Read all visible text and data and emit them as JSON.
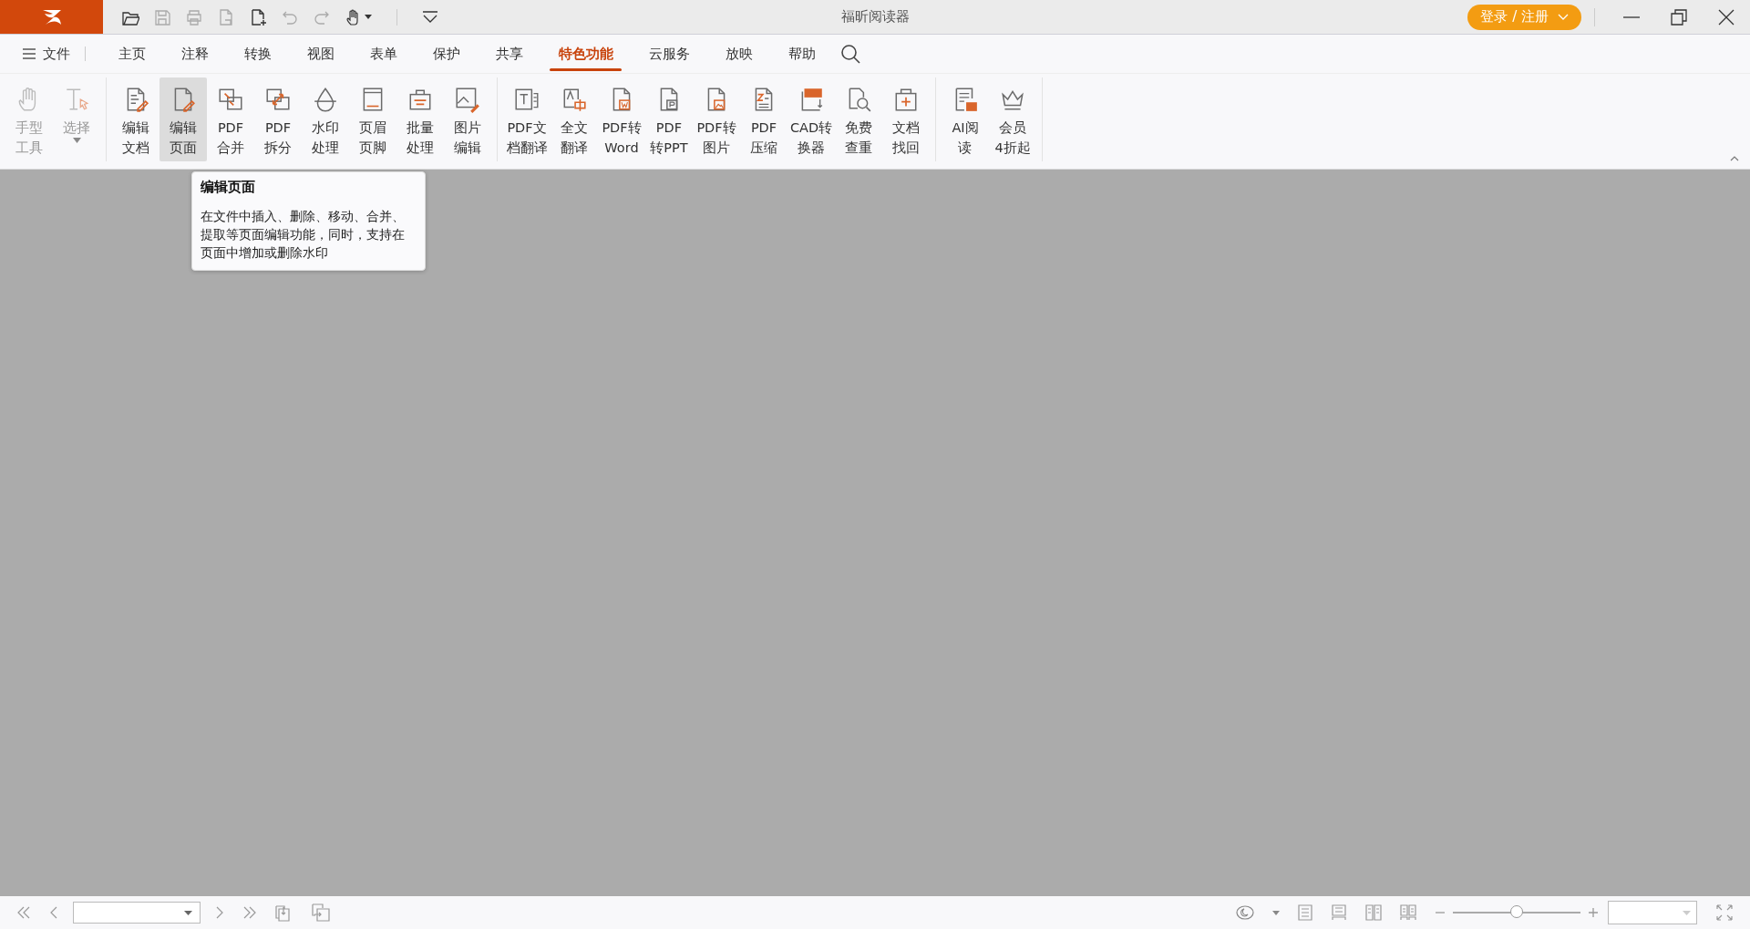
{
  "window": {
    "title": "福昕阅读器"
  },
  "quick_access": [
    {
      "kind": "folder",
      "disabled": false
    },
    {
      "kind": "save",
      "disabled": true
    },
    {
      "kind": "print",
      "disabled": true
    },
    {
      "kind": "doc",
      "disabled": true
    },
    {
      "kind": "new",
      "disabled": false
    },
    {
      "kind": "undo",
      "disabled": true
    },
    {
      "kind": "redo",
      "disabled": true
    },
    {
      "kind": "hand",
      "disabled": false
    }
  ],
  "login_button": {
    "label": "登录 / 注册"
  },
  "menu": {
    "file": "文件",
    "tabs": [
      {
        "label": "主页",
        "selected": false
      },
      {
        "label": "注释",
        "selected": false
      },
      {
        "label": "转换",
        "selected": false
      },
      {
        "label": "视图",
        "selected": false
      },
      {
        "label": "表单",
        "selected": false
      },
      {
        "label": "保护",
        "selected": false
      },
      {
        "label": "共享",
        "selected": false
      },
      {
        "label": "特色功能",
        "selected": true
      },
      {
        "label": "云服务",
        "selected": false
      },
      {
        "label": "放映",
        "selected": false
      },
      {
        "label": "帮助",
        "selected": false
      }
    ]
  },
  "ribbon": {
    "groups": [
      {
        "tools": [
          {
            "kind": "hand",
            "lines": [
              "手型",
              "工具"
            ],
            "disabled": true,
            "selected": false
          },
          {
            "kind": "select",
            "lines": [
              "选择"
            ],
            "disabled": true,
            "selected": false
          }
        ]
      },
      {
        "tools": [
          {
            "kind": "edit-doc",
            "lines": [
              "编辑",
              "文档"
            ],
            "disabled": false,
            "selected": false
          },
          {
            "kind": "edit-page",
            "lines": [
              "编辑",
              "页面"
            ],
            "disabled": false,
            "selected": true
          },
          {
            "kind": "merge",
            "lines": [
              "PDF",
              "合并"
            ],
            "disabled": false,
            "selected": false
          },
          {
            "kind": "split",
            "lines": [
              "PDF",
              "拆分"
            ],
            "disabled": false,
            "selected": false
          },
          {
            "kind": "watermark",
            "lines": [
              "水印",
              "处理"
            ],
            "disabled": false,
            "selected": false
          },
          {
            "kind": "header",
            "lines": [
              "页眉",
              "页脚"
            ],
            "disabled": false,
            "selected": false
          },
          {
            "kind": "batch",
            "lines": [
              "批量",
              "处理"
            ],
            "disabled": false,
            "selected": false
          },
          {
            "kind": "image",
            "lines": [
              "图片",
              "编辑"
            ],
            "disabled": false,
            "selected": false
          }
        ]
      },
      {
        "tools": [
          {
            "kind": "translate-doc",
            "lines": [
              "PDF文",
              "档翻译"
            ],
            "disabled": false,
            "selected": false
          },
          {
            "kind": "translate",
            "lines": [
              "全文",
              "翻译"
            ],
            "disabled": false,
            "selected": false
          },
          {
            "kind": "to-word",
            "lines": [
              "PDF转",
              "Word"
            ],
            "disabled": false,
            "selected": false
          },
          {
            "kind": "to-ppt",
            "lines": [
              "PDF",
              "转PPT"
            ],
            "disabled": false,
            "selected": false
          },
          {
            "kind": "to-image",
            "lines": [
              "PDF转",
              "图片"
            ],
            "disabled": false,
            "selected": false
          },
          {
            "kind": "compress",
            "lines": [
              "PDF",
              "压缩"
            ],
            "disabled": false,
            "selected": false
          },
          {
            "kind": "cad",
            "lines": [
              "CAD转",
              "换器"
            ],
            "disabled": false,
            "selected": false
          },
          {
            "kind": "check",
            "lines": [
              "免费",
              "查重"
            ],
            "disabled": false,
            "selected": false
          },
          {
            "kind": "recover",
            "lines": [
              "文档",
              "找回"
            ],
            "disabled": false,
            "selected": false
          }
        ]
      },
      {
        "tools": [
          {
            "kind": "ai",
            "lines": [
              "AI阅",
              "读"
            ],
            "disabled": false,
            "selected": false
          },
          {
            "kind": "crown",
            "lines": [
              "会员",
              "4折起"
            ],
            "disabled": false,
            "selected": false
          }
        ]
      }
    ]
  },
  "tooltip": {
    "title": "编辑页面",
    "text": "在文件中插入、删除、移动、合并、提取等页面编辑功能，同时，支持在页面中增加或删除水印"
  },
  "status_bar": {
    "zoom_slider": {
      "level": 0.5
    }
  }
}
